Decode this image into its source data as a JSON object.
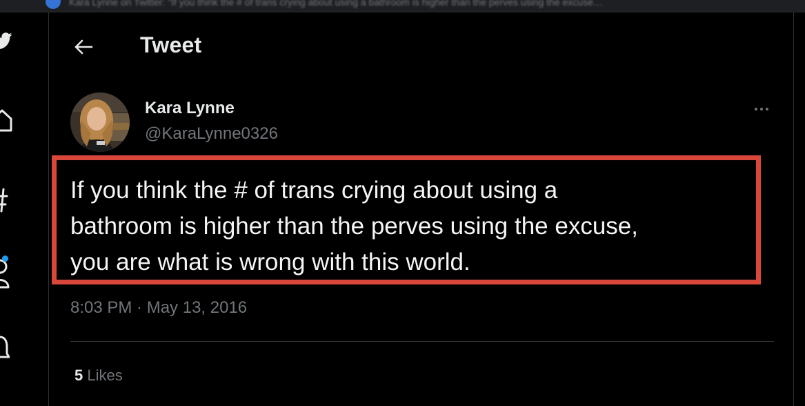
{
  "header": {
    "title": "Tweet",
    "back_icon": "arrow-left-icon"
  },
  "browser_strip": {
    "text": "Kara Lynne on Twitter: \"If you think the # of trans crying about using a bathroom is higher than the perves using the excuse…"
  },
  "nav": {
    "icons": [
      "twitter-logo-icon",
      "home-icon",
      "hashtag-icon",
      "profile-icon",
      "bell-icon"
    ],
    "notification_dot_color": "#1d9bf0"
  },
  "tweet": {
    "author_name": "Kara Lynne",
    "author_handle": "@KaraLynne0326",
    "text_lines": [
      "If you think the # of trans crying about using a",
      "bathroom is higher than the perves using the excuse,",
      "you are what is wrong with this world."
    ],
    "timestamp": "8:03 PM · May 13, 2016",
    "likes_count": "5",
    "likes_label": "Likes",
    "highlight_color": "#d9473a"
  },
  "colors": {
    "background": "#000000",
    "text_primary": "#e7e9ea",
    "text_secondary": "#71767b",
    "divider": "#2f3336"
  }
}
